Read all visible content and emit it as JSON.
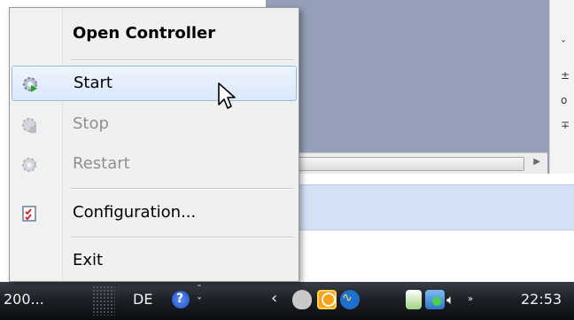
{
  "menu": {
    "items": [
      {
        "label": "Open Controller",
        "state": "bold",
        "icon": null
      },
      {
        "label": "Start",
        "state": "hover",
        "icon": "gear-start-icon"
      },
      {
        "label": "Stop",
        "state": "disabled",
        "icon": "gear-stop-icon"
      },
      {
        "label": "Restart",
        "state": "disabled",
        "icon": "gear-restart-icon"
      },
      {
        "label": "Configuration...",
        "state": "normal",
        "icon": "checklist-icon"
      },
      {
        "label": "Exit",
        "state": "normal",
        "icon": null
      }
    ]
  },
  "taskbar": {
    "left_text": "200...",
    "language": "DE",
    "clock": "22:53",
    "tray_icons": [
      "chevron-left-icon",
      "heart-icon",
      "clock-icon",
      "pulse-icon",
      "usb-icon",
      "network-icon",
      "volume-icon"
    ]
  },
  "colors": {
    "menu_hover": "#d9e8fb",
    "panel": "#959fb8",
    "band": "#d3e1f7"
  }
}
